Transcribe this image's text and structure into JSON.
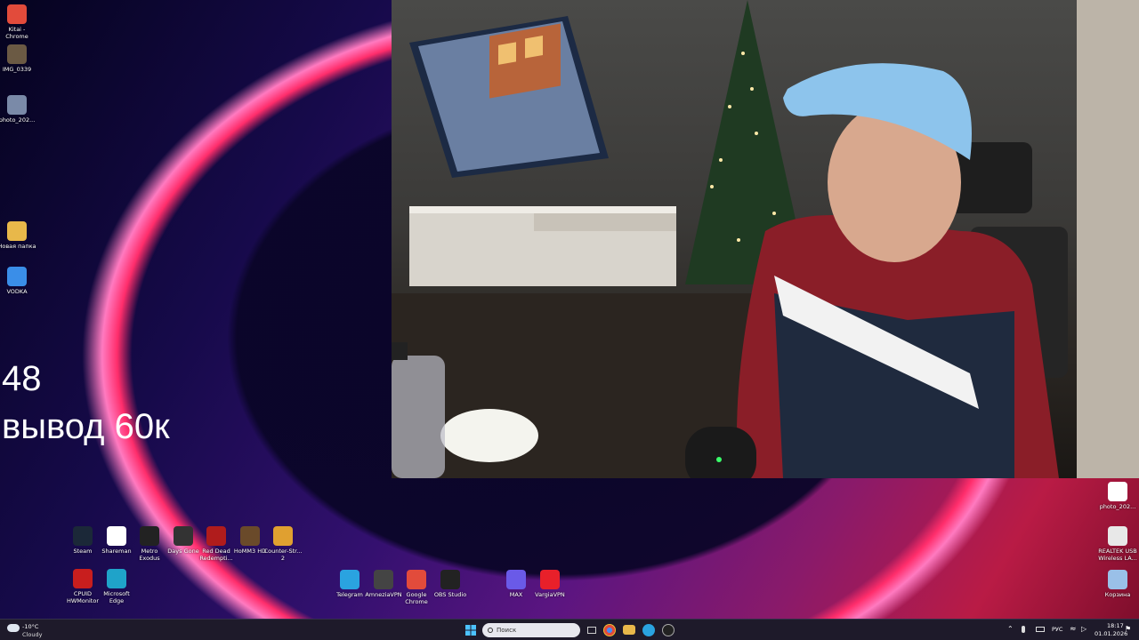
{
  "overlay": {
    "line1": "48",
    "line2": "вывод 60к"
  },
  "left_icons": [
    {
      "name": "kitai-chrome-icon",
      "label": "Kitai - Chrome",
      "color": "#e24b3b"
    },
    {
      "name": "img-0339-icon",
      "label": "IMG_0339",
      "color": "#6b5a44"
    },
    {
      "name": "photo-icon",
      "label": "photo_202...",
      "color": "#7a8aa8"
    },
    {
      "name": "folder-icon",
      "label": "Новая папка",
      "color": "#e8b84a"
    },
    {
      "name": "vodka-icon",
      "label": "VODKA",
      "color": "#3a8ee8"
    }
  ],
  "app_row1": [
    {
      "name": "steam-icon",
      "label": "Steam",
      "color": "#1b2838"
    },
    {
      "name": "shareman-icon",
      "label": "Shareman",
      "color": "#ffffff"
    },
    {
      "name": "metro-exodus-icon",
      "label": "Metro Exodus",
      "color": "#222"
    },
    {
      "name": "days-gone-icon",
      "label": "Days Gone",
      "color": "#333"
    },
    {
      "name": "rdr-icon",
      "label": "Red Dead Redempti...",
      "color": "#b01c1c"
    },
    {
      "name": "homm3-icon",
      "label": "HoMM3 HD",
      "color": "#6a4a2a"
    },
    {
      "name": "cs2-icon",
      "label": "Counter-Str... 2",
      "color": "#e0a030"
    }
  ],
  "app_row2": [
    {
      "name": "cpuid-icon",
      "label": "CPUID HWMonitor",
      "color": "#c81e1e"
    },
    {
      "name": "edge-icon",
      "label": "Microsoft Edge",
      "color": "#1fa3c9"
    }
  ],
  "app_row3": [
    {
      "name": "telegram-icon",
      "label": "Telegram",
      "color": "#2aa3e0"
    },
    {
      "name": "amneziavpn-icon",
      "label": "AmneziaVPN",
      "color": "#444"
    },
    {
      "name": "google-chrome-icon",
      "label": "Google Chrome",
      "color": "#e24b3b"
    },
    {
      "name": "obs-icon",
      "label": "OBS Studio",
      "color": "#222"
    }
  ],
  "app_row4": [
    {
      "name": "max-icon",
      "label": "MAX",
      "color": "#6a5ae8"
    },
    {
      "name": "vpn-icon",
      "label": "VargiaVPN",
      "color": "#e8202a"
    }
  ],
  "right_icons": [
    {
      "name": "qr-photo-icon",
      "label": "photo_202...",
      "color": "#ffffff"
    },
    {
      "name": "realtek-icon",
      "label": "REALTEK USB Wireless LA...",
      "color": "#e8e8e8"
    },
    {
      "name": "recycle-bin-icon",
      "label": "Корзина",
      "color": "#9ac0e8"
    }
  ],
  "taskbar": {
    "weather_temp": "-10°C",
    "weather_desc": "Cloudy",
    "search_placeholder": "Поиск",
    "lang": "РУС",
    "time": "18:17",
    "date": "01.01.2026"
  }
}
